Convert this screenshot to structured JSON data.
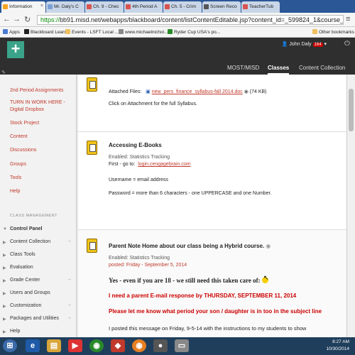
{
  "browser": {
    "tabs": [
      {
        "label": "Information",
        "color": "#f5a623"
      },
      {
        "label": "Mr. Daly's C",
        "color": "#7aa0d6"
      },
      {
        "label": "Ch. 9 - Chec",
        "color": "#d9534f"
      },
      {
        "label": "4th Period A",
        "color": "#d9534f"
      },
      {
        "label": "Ch. 5 - Crim",
        "color": "#d9534f"
      },
      {
        "label": "Screen Reco",
        "color": "#555555"
      },
      {
        "label": "TeacherTub",
        "color": "#d9534f"
      }
    ],
    "url_scheme": "https://",
    "url_rest": "bb91.misd.net/webapps/blackboard/content/listContentEditable.jsp?content_id=_599824_1&course_id=_94855_1&",
    "bookmarks": [
      "Apps",
      "Blackboard Learn",
      "Events - LSFT Local ...",
      "www.michaelnichol...",
      "Ryder Cup USA's po..."
    ],
    "other_bookmarks": "Other bookmarks"
  },
  "header": {
    "user_name": "John Daly",
    "notification_count": "164",
    "nav": [
      "MOST/MISD",
      "Classes",
      "Content Collection"
    ],
    "active_nav": "Classes"
  },
  "sidebar": {
    "course_links": [
      "2nd Period Assignments",
      "TURN IN WORK HERE -",
      "Digital Dropbox",
      "Stock Project",
      "Content",
      "Discussions",
      "Groups",
      "Tools",
      "Help"
    ],
    "section_label": "CLASS MANAGEMENT",
    "control_panel": "Control Panel",
    "panel_items": [
      "Content Collection",
      "Class Tools",
      "Evaluation",
      "Grade Center",
      "Users and Groups",
      "Customization",
      "Packages and Utilities",
      "Help"
    ]
  },
  "content": {
    "item1": {
      "attached_label": "Attached Files:",
      "file_name": "new_pers_finance_syllabus-fall 2014.doc",
      "file_size": "(74 KB)",
      "instruction": "Click on Attachment for the full Syllabus."
    },
    "item2": {
      "title": "Accessing E-Books",
      "meta": "Enabled:  Statistics Tracking",
      "first_goto": "First - go to:",
      "link": "login.cengagebrain.com",
      "username": "Username = email address",
      "password": "Password = more than 6 characters - one UPPERCASE and one Number."
    },
    "item3": {
      "title": "Parent Note Home about our class being a Hybrid course.",
      "meta": "Enabled:  Statistics Tracking",
      "posted": "posted: Friday -  September 5, 2014",
      "line1": "Yes - even if you are 18 - we still need this taken care of:",
      "line2": "I need a parent E-mail response by THURSDAY, SEPTEMBER 11, 2014",
      "line3": "Please let me know what period your son / daughter is in too in the subject line",
      "line4": "I posted this message on Friday, 9-5-14  with the instructions to my students to show"
    }
  },
  "taskbar": {
    "time": "8:27 AM",
    "date": "10/30/2014"
  }
}
